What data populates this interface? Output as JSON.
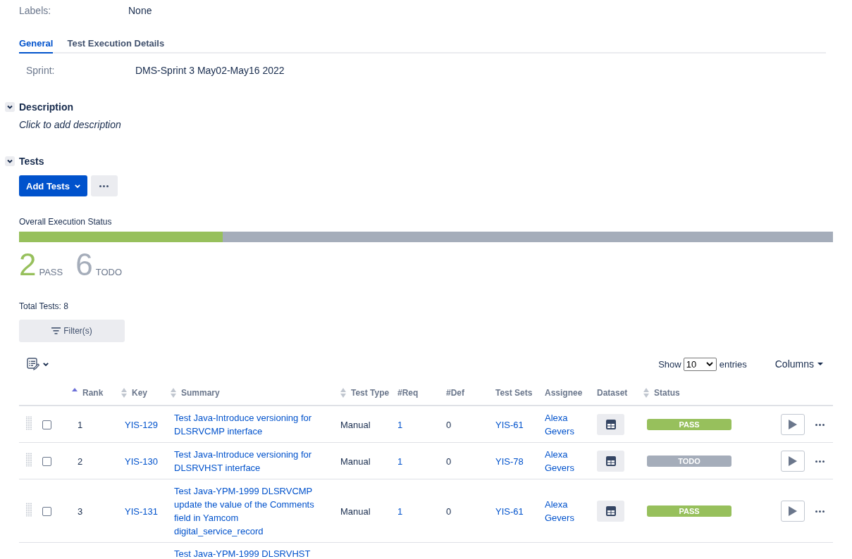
{
  "fields": [
    {
      "label": "Labels:",
      "value": "None"
    }
  ],
  "tabs": [
    {
      "label": "General",
      "selected": true
    },
    {
      "label": "Test Execution Details",
      "selected": false
    }
  ],
  "tab_fields": [
    {
      "label": "Sprint:",
      "value": "DMS-Sprint 3 May02-May16 2022"
    }
  ],
  "description": {
    "title": "Description",
    "expanded": true,
    "prompt": "Click to add description"
  },
  "tests": {
    "title": "Tests",
    "expanded": true,
    "add_button": "Add Tests",
    "execution": {
      "title": "Overall Execution Status",
      "level": 0.25,
      "counts": [
        {
          "count": "2",
          "label": "PASS",
          "color": "#97c05c"
        },
        {
          "count": "6",
          "label": "TODO",
          "color": "#a5adba"
        }
      ]
    },
    "total": "Total Tests: 8",
    "filter_button": "Filter(s)",
    "page_size": {
      "label": "Show",
      "value": "10",
      "suffix": "entries"
    },
    "columns_button": "Columns",
    "table": {
      "columns": [
        {
          "label": "Rank",
          "sorted": true
        },
        {
          "label": "Key",
          "sorted": false
        },
        {
          "label": "Summary",
          "sorted": false
        },
        {
          "label": "Test Type",
          "sorted": false
        },
        {
          "label": "#Req"
        },
        {
          "label": "#Def"
        },
        {
          "label": "Test Sets"
        },
        {
          "label": "Assignee"
        },
        {
          "label": "Dataset"
        },
        {
          "label": "Status",
          "sorted": false
        }
      ],
      "rows": [
        {
          "kind": "full",
          "checked": false,
          "rank": "1",
          "key": "YIS-129",
          "summary": "Test Java-Introduce versioning for DLSRVCMP interface",
          "test_type": "Manual",
          "req": "1",
          "def": "0",
          "test_sets": "YIS-61",
          "assignee": "Alexa Gevers",
          "status": {
            "label": "PASS",
            "color": "#97c05c"
          }
        },
        {
          "kind": "full",
          "checked": false,
          "rank": "2",
          "key": "YIS-130",
          "summary": "Test Java-Introduce versioning for DLSRVHST interface",
          "test_type": "Manual",
          "req": "1",
          "def": "0",
          "test_sets": "YIS-78",
          "assignee": "Alexa Gevers",
          "status": {
            "label": "TODO",
            "color": "#a5adba"
          }
        },
        {
          "kind": "full",
          "checked": false,
          "rank": "3",
          "key": "YIS-131",
          "summary": "Test Java-YPM-1999 DLSRVCMP update the value of the Comments field in Yamcom digital_service_record",
          "test_type": "Manual",
          "req": "1",
          "def": "0",
          "test_sets": "YIS-61",
          "assignee": "Alexa Gevers",
          "status": {
            "label": "PASS",
            "color": "#97c05c"
          }
        },
        {
          "kind": "partial",
          "summary": "Test Java-YPM-1999 DLSRVHST"
        }
      ]
    }
  }
}
